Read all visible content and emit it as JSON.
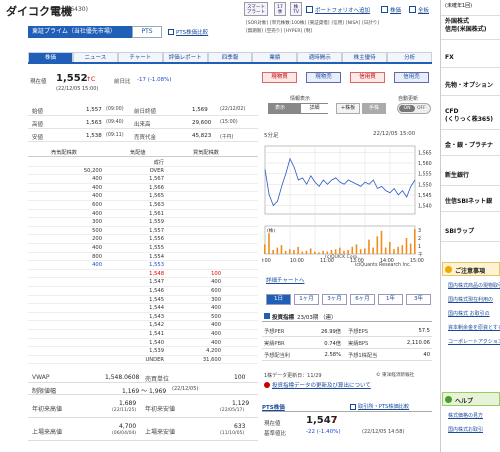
{
  "header": {
    "title": "ダイコク電機",
    "code": "(6430)",
    "alert_btn": "スマートアラート",
    "btn_17": "17季",
    "btn_tv": "株TV",
    "portfolio_link": "ポートフォリオへ追加",
    "news_link": "株価",
    "board_link": "全板",
    "tags": [
      "[SOR対象]",
      "[単元株数:100株]",
      "[東証貸借]",
      "[信用]",
      "[NISA]",
      "[日計り]",
      "[無期限]",
      "[空売り]",
      "[HYPER]",
      "[制]"
    ],
    "market_label": "東証プライム（当社優先市場）",
    "pts_label": "PTS",
    "pts_link": "PTS株価比較"
  },
  "tabs": [
    "株価",
    "ニュース",
    "チャート",
    "評価レポート",
    "四季報",
    "業績",
    "適時開示",
    "株主優待",
    "分析"
  ],
  "quote": {
    "current_label": "現在値",
    "current_price": "1,552",
    "current_suffix": "↑C",
    "change_label": "前日比",
    "change_value": "-17 (-1.08%)",
    "time": "(22/12/05 15:00)"
  },
  "stats": [
    {
      "l1": "始値",
      "v1": "1,557",
      "t1": "(09:00)",
      "l2": "前日終値",
      "v2": "1,569",
      "t2": "(22/12/02)"
    },
    {
      "l1": "高値",
      "v1": "1,563",
      "t1": "(09:40)",
      "l2": "出来高",
      "v2": "29,600",
      "t2": "(15:00)"
    },
    {
      "l1": "安値",
      "v1": "1,538",
      "t1": "(09:11)",
      "l2": "売買代金",
      "v2": "45,823",
      "t2": "(千円)"
    }
  ],
  "board": {
    "col_sell": "売気配株数",
    "col_price": "気配値",
    "col_buy": "買気配株数",
    "rows": [
      {
        "s": "",
        "p": "成行",
        "b": ""
      },
      {
        "s": "50,200",
        "p": "OVER",
        "b": ""
      },
      {
        "s": "400",
        "p": "1,567",
        "b": ""
      },
      {
        "s": "400",
        "p": "1,566",
        "b": ""
      },
      {
        "s": "400",
        "p": "1,565",
        "b": ""
      },
      {
        "s": "600",
        "p": "1,563",
        "b": ""
      },
      {
        "s": "400",
        "p": "1,561",
        "b": ""
      },
      {
        "s": "300",
        "p": "1,559",
        "b": ""
      },
      {
        "s": "500",
        "p": "1,557",
        "b": ""
      },
      {
        "s": "200",
        "p": "1,556",
        "b": ""
      },
      {
        "s": "400",
        "p": "1,555",
        "b": ""
      },
      {
        "s": "800",
        "p": "1,554",
        "b": ""
      },
      {
        "s": "400",
        "p": "1,553",
        "b": ""
      },
      {
        "s": "",
        "p": "1,548",
        "b": "100"
      },
      {
        "s": "",
        "p": "1,547",
        "b": "400"
      },
      {
        "s": "",
        "p": "1,546",
        "b": "600"
      },
      {
        "s": "",
        "p": "1,545",
        "b": "300"
      },
      {
        "s": "",
        "p": "1,544",
        "b": "400"
      },
      {
        "s": "",
        "p": "1,543",
        "b": "500"
      },
      {
        "s": "",
        "p": "1,542",
        "b": "400"
      },
      {
        "s": "",
        "p": "1,541",
        "b": "400"
      },
      {
        "s": "",
        "p": "1,540",
        "b": "400"
      },
      {
        "s": "",
        "p": "1,539",
        "b": "4,200"
      },
      {
        "s": "",
        "p": "UNDER",
        "b": "31,600"
      }
    ]
  },
  "lower": {
    "vwap_label": "VWAP",
    "vwap": "1,548.0608",
    "unit_label": "売買単位",
    "unit": "100",
    "limit_label": "制限値幅",
    "limit": "1,169 ～ 1,969",
    "limit_date": "(22/12/05)",
    "ytd_high_label": "年初来高値",
    "ytd_high": "1,689",
    "ytd_high_date": "(22/11/25)",
    "ytd_low_label": "年初来安値",
    "ytd_low": "1,129",
    "ytd_low_date": "(22/05/17)",
    "list_high_label": "上場来高値",
    "list_high": "4,700",
    "list_high_date": "(06/04/04)",
    "list_low_label": "上場来安値",
    "list_low": "633",
    "list_low_date": "(11/10/05)"
  },
  "chart_ctrl": {
    "tabs": [
      "現物買",
      "現物売",
      "信用買",
      "信用売"
    ],
    "info_label": "情報表示",
    "sum_label": "表示",
    "detail_label": "詳細",
    "auto_label": "自動更新",
    "on": "ON",
    "off": "OFF",
    "buy": "+株板",
    "sell": "手株"
  },
  "chart_header": {
    "interval": "5分足",
    "datetime": "22/12/05 15:00",
    "credit": "(c)QUICK Corp.",
    "credit2": "iciQuants Research Inc.",
    "detail_link": "詳細チャートへ"
  },
  "chart_data": {
    "type": "line",
    "x": [
      "9:00",
      "10:00",
      "11:00",
      "13:00",
      "14:00",
      "15:00"
    ],
    "yticks": [
      1565,
      1560,
      1555,
      1550,
      1545,
      1540
    ],
    "ylim": [
      1536,
      1568
    ],
    "prices": [
      1557,
      1545,
      1540,
      1542,
      1549,
      1555,
      1562,
      1558,
      1552,
      1553,
      1550,
      1554,
      1551,
      1549,
      1552,
      1550,
      1552,
      1553,
      1551,
      1550,
      1552,
      1551,
      1550,
      1549,
      1551,
      1550,
      1552,
      1548,
      1549,
      1547,
      1546,
      1548,
      1545,
      1547,
      1544,
      1549,
      1552
    ],
    "volume_label": "(株)",
    "vol_ticks": [
      3,
      2,
      1
    ],
    "vol_unit": "千",
    "volumes": [
      1.2,
      2.6,
      0.5,
      0.8,
      1.1,
      0.4,
      0.6,
      0.5,
      0.9,
      0.3,
      0.4,
      0.7,
      0.3,
      0.2,
      0.4,
      0.3,
      0.5,
      0.6,
      0.8,
      0.4,
      0.5,
      0.9,
      1.2,
      0.6,
      0.7,
      1.8,
      0.8,
      2.2,
      2.9,
      0.8,
      1.5,
      0.6,
      0.9,
      1.1,
      2.0,
      1.3,
      3.1
    ]
  },
  "periods": [
    "1日",
    "1ヶ月",
    "3ヶ月",
    "6ヶ月",
    "1年",
    "3年"
  ],
  "indicators": {
    "title": "投資指標",
    "date": "23/03期",
    "source": "（連）",
    "rows": [
      {
        "l": "予想PER",
        "v": "26.99倍",
        "l2": "予想EPS",
        "v2": "57.5"
      },
      {
        "l": "実績PBR",
        "v": "0.74倍",
        "l2": "実績BPS",
        "v2": "2,110.06"
      },
      {
        "l": "予想配当利",
        "v": "2.58%",
        "l2": "予想1株配当",
        "v2": "40"
      }
    ],
    "update": "1株データ更新日：11/29",
    "disclaimer": "© 東洋経済新報社",
    "foot_link": "投資指標データの更新及び算出について"
  },
  "pts": {
    "title": "PTS株価",
    "link": "取引所・PTS株価比較",
    "current_label": "現在値",
    "current": "1,547",
    "current_suffix": "↑",
    "change_label": "基準値比",
    "change": "-22 (-1.40%)",
    "time": "(22/12/05 14:58)"
  },
  "sidebar": {
    "items": [
      "(未確年1回)",
      "外国株式\n信用(米国株式)",
      "FX",
      "先物・オプション",
      "CFD\n(くりっく株365)",
      "金・銀・プラチナ",
      "新生銀行",
      "住信SBIネット銀",
      "SBIラップ"
    ],
    "notice_title": "ご注意事項",
    "notices": [
      "国内株式商品の現物取引の",
      "国内株式現在利用の",
      "国内株式 お取引の",
      "資本剰余金を原資とする当",
      "コーポレートアクション"
    ],
    "help_title": "ヘルプ",
    "help_links": [
      "株式価格の見方",
      "国内株式お取引"
    ]
  }
}
